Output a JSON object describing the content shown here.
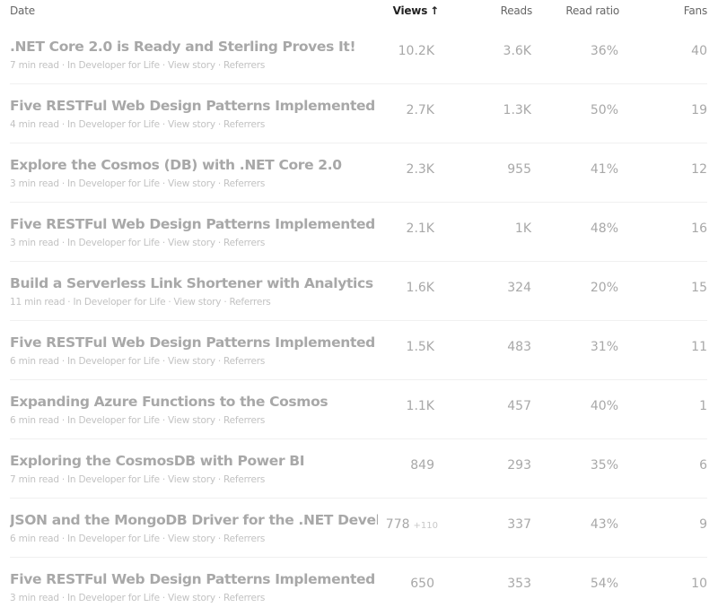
{
  "header": {
    "date": "Date",
    "views": "Views",
    "views_sort_icon": "↑",
    "reads": "Reads",
    "read_ratio": "Read ratio",
    "fans": "Fans"
  },
  "rows": [
    {
      "title": ".NET Core 2.0 is Ready and Sterling Proves It!",
      "read_time": "7 min read",
      "publication": "In Developer for Life",
      "view_story": "View story",
      "referrers": "Referrers",
      "views": "10.2K",
      "views_delta": "",
      "reads": "3.6K",
      "read_ratio": "36%",
      "fans": "40"
    },
    {
      "title": "Five RESTFul Web Design Patterns Implemented in ...",
      "read_time": "4 min read",
      "publication": "In Developer for Life",
      "view_story": "View story",
      "referrers": "Referrers",
      "views": "2.7K",
      "views_delta": "",
      "reads": "1.3K",
      "read_ratio": "50%",
      "fans": "19"
    },
    {
      "title": "Explore the Cosmos (DB) with .NET Core 2.0",
      "read_time": "3 min read",
      "publication": "In Developer for Life",
      "view_story": "View story",
      "referrers": "Referrers",
      "views": "2.3K",
      "views_delta": "",
      "reads": "955",
      "read_ratio": "41%",
      "fans": "12"
    },
    {
      "title": "Five RESTFul Web Design Patterns Implemented in ...",
      "read_time": "3 min read",
      "publication": "In Developer for Life",
      "view_story": "View story",
      "referrers": "Referrers",
      "views": "2.1K",
      "views_delta": "",
      "reads": "1K",
      "read_ratio": "48%",
      "fans": "16"
    },
    {
      "title": "Build a Serverless Link Shortener with Analytics Fas...",
      "read_time": "11 min read",
      "publication": "In Developer for Life",
      "view_story": "View story",
      "referrers": "Referrers",
      "views": "1.6K",
      "views_delta": "",
      "reads": "324",
      "read_ratio": "20%",
      "fans": "15"
    },
    {
      "title": "Five RESTFul Web Design Patterns Implemented in ...",
      "read_time": "6 min read",
      "publication": "In Developer for Life",
      "view_story": "View story",
      "referrers": "Referrers",
      "views": "1.5K",
      "views_delta": "",
      "reads": "483",
      "read_ratio": "31%",
      "fans": "11"
    },
    {
      "title": "Expanding Azure Functions to the Cosmos",
      "read_time": "6 min read",
      "publication": "In Developer for Life",
      "view_story": "View story",
      "referrers": "Referrers",
      "views": "1.1K",
      "views_delta": "",
      "reads": "457",
      "read_ratio": "40%",
      "fans": "1"
    },
    {
      "title": "Exploring the CosmosDB with Power BI",
      "read_time": "7 min read",
      "publication": "In Developer for Life",
      "view_story": "View story",
      "referrers": "Referrers",
      "views": "849",
      "views_delta": "",
      "reads": "293",
      "read_ratio": "35%",
      "fans": "6"
    },
    {
      "title": "JSON and the MongoDB Driver for the .NET Developer",
      "read_time": "6 min read",
      "publication": "In Developer for Life",
      "view_story": "View story",
      "referrers": "Referrers",
      "views": "778",
      "views_delta": "+110",
      "reads": "337",
      "read_ratio": "43%",
      "fans": "9"
    },
    {
      "title": "Five RESTFul Web Design Patterns Implemented in ...",
      "read_time": "3 min read",
      "publication": "In Developer for Life",
      "view_story": "View story",
      "referrers": "Referrers",
      "views": "650",
      "views_delta": "",
      "reads": "353",
      "read_ratio": "54%",
      "fans": "10"
    }
  ],
  "separator": "·"
}
